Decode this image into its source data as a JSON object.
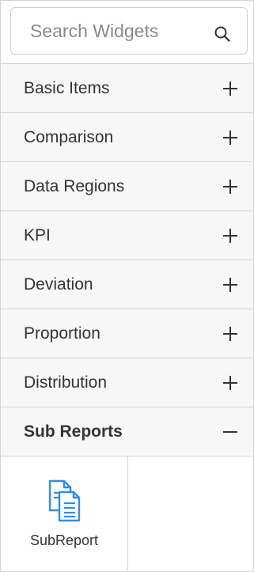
{
  "search": {
    "placeholder": "Search Widgets",
    "value": ""
  },
  "categories": [
    {
      "label": "Basic Items",
      "state": "collapsed",
      "toggle_icon": "plus-icon"
    },
    {
      "label": "Comparison",
      "state": "collapsed",
      "toggle_icon": "plus-icon"
    },
    {
      "label": "Data Regions",
      "state": "collapsed",
      "toggle_icon": "plus-icon"
    },
    {
      "label": "KPI",
      "state": "collapsed",
      "toggle_icon": "plus-icon"
    },
    {
      "label": "Deviation",
      "state": "collapsed",
      "toggle_icon": "plus-icon"
    },
    {
      "label": "Proportion",
      "state": "collapsed",
      "toggle_icon": "plus-icon"
    },
    {
      "label": "Distribution",
      "state": "collapsed",
      "toggle_icon": "plus-icon"
    },
    {
      "label": "Sub Reports",
      "state": "expanded",
      "toggle_icon": "minus-icon"
    }
  ],
  "sub_reports_items": [
    {
      "label": "SubReport",
      "icon": "subreport-document-icon"
    }
  ],
  "colors": {
    "accent_icon": "#2f8df0",
    "category_bg": "#f7f7f7",
    "border": "#d3d3d3"
  }
}
